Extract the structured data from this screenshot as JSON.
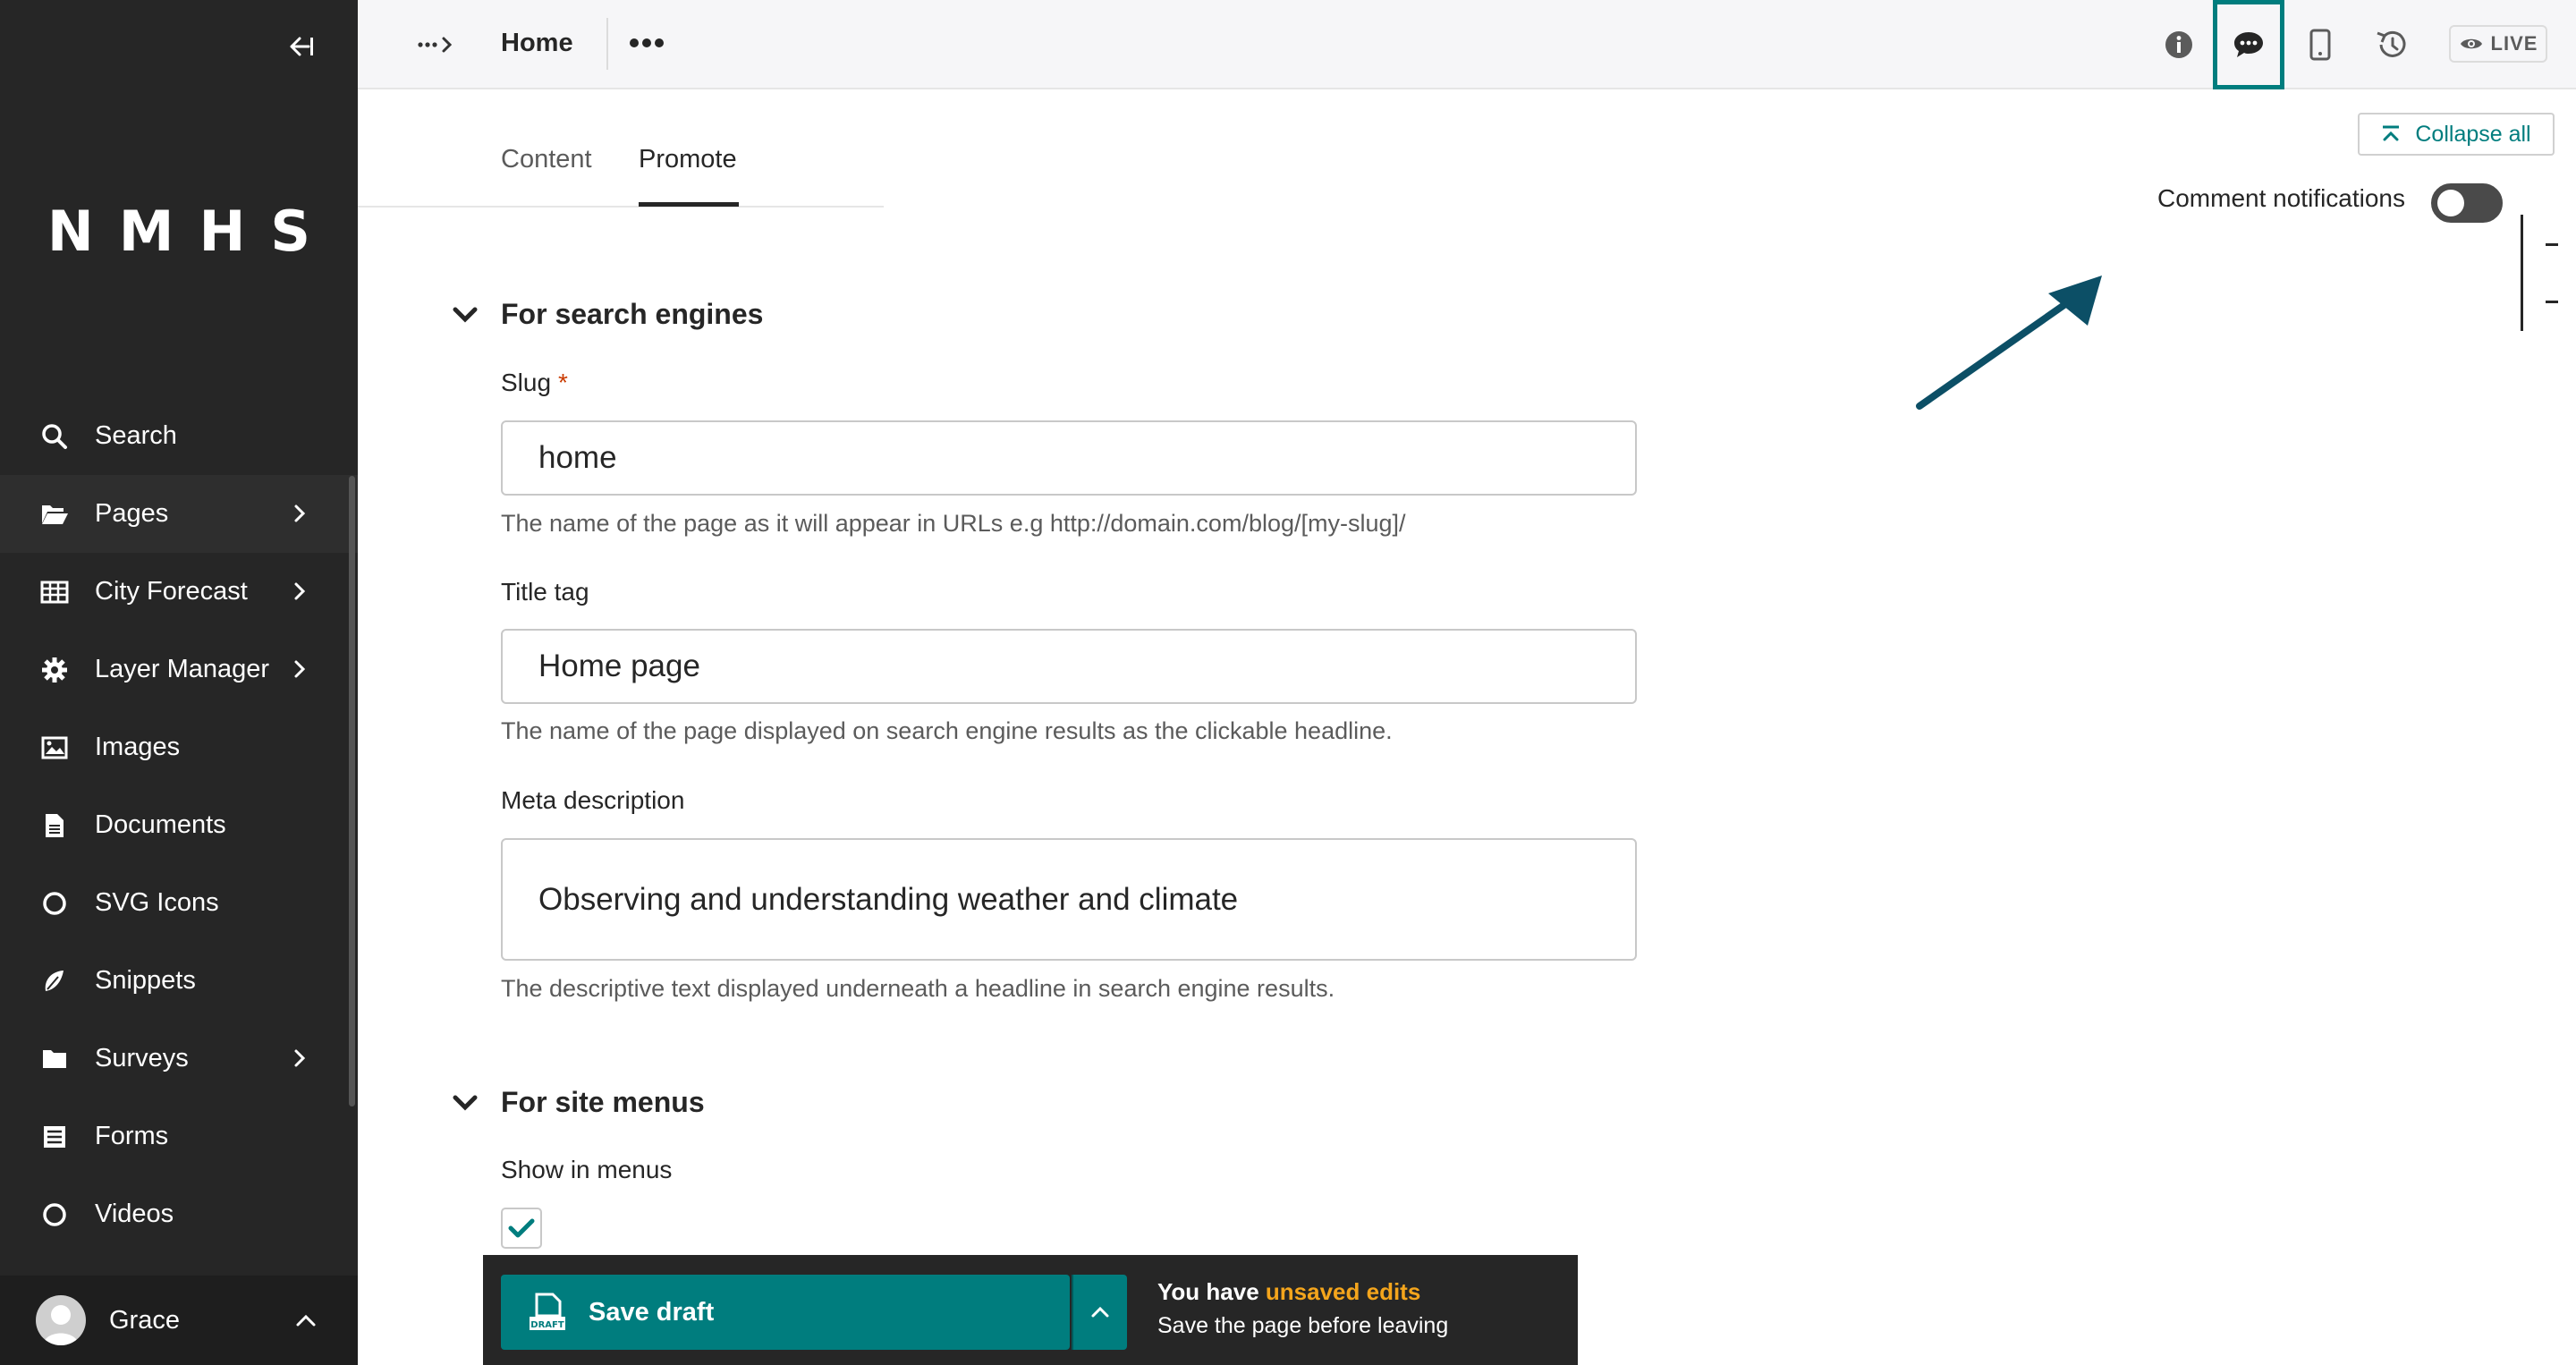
{
  "sidebar": {
    "logo": "NMHS",
    "items": [
      {
        "label": "Search",
        "icon": "search-icon",
        "has_children": false
      },
      {
        "label": "Pages",
        "icon": "folder-open-icon",
        "has_children": true
      },
      {
        "label": "City Forecast",
        "icon": "table-icon",
        "has_children": true
      },
      {
        "label": "Layer Manager",
        "icon": "cog-icon",
        "has_children": true
      },
      {
        "label": "Images",
        "icon": "image-icon",
        "has_children": false
      },
      {
        "label": "Documents",
        "icon": "document-icon",
        "has_children": false
      },
      {
        "label": "SVG Icons",
        "icon": "circle-icon",
        "has_children": false
      },
      {
        "label": "Snippets",
        "icon": "snippet-icon",
        "has_children": false
      },
      {
        "label": "Surveys",
        "icon": "folder-icon",
        "has_children": true
      },
      {
        "label": "Forms",
        "icon": "form-icon",
        "has_children": false
      },
      {
        "label": "Videos",
        "icon": "circle-icon",
        "has_children": false
      }
    ],
    "account": {
      "name": "Grace"
    }
  },
  "header": {
    "title": "Home",
    "live_label": "LIVE"
  },
  "tabs": [
    {
      "label": "Content",
      "active": false
    },
    {
      "label": "Promote",
      "active": true
    }
  ],
  "controls": {
    "collapse_all": "Collapse all",
    "comment_notifications": "Comment notifications",
    "comment_notifications_on": false
  },
  "form": {
    "search_section": "For search engines",
    "slug": {
      "label": "Slug",
      "required_mark": "*",
      "value": "home",
      "help": "The name of the page as it will appear in URLs e.g http://domain.com/blog/[my-slug]/"
    },
    "title_tag": {
      "label": "Title tag",
      "value": "Home page",
      "help": "The name of the page displayed on search engine results as the clickable headline."
    },
    "meta_description": {
      "label": "Meta description",
      "value": "Observing and understanding weather and climate",
      "help": "The descriptive text displayed underneath a headline in search engine results."
    },
    "menus_section": "For site menus",
    "show_in_menus": {
      "label": "Show in menus",
      "checked": true
    }
  },
  "footer": {
    "save_label": "Save draft",
    "draft_badge": "DRAFT",
    "msg_prefix": "You have",
    "msg_highlight": "unsaved edits",
    "msg_line2": "Save the page before leaving"
  },
  "colors": {
    "accent": "#007d7e",
    "sidebar_bg": "#262626",
    "warning": "#f4a51c",
    "arrow": "#0c4f66"
  }
}
